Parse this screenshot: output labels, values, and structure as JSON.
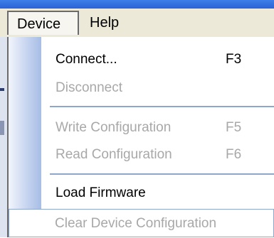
{
  "menubar": {
    "items": [
      {
        "label": "Device"
      },
      {
        "label": "Help"
      }
    ]
  },
  "dropdown": {
    "items": [
      {
        "label": "Connect...",
        "shortcut": "F3",
        "enabled": true
      },
      {
        "label": "Disconnect",
        "shortcut": "",
        "enabled": false
      },
      {
        "label": "Write Configuration",
        "shortcut": "F5",
        "enabled": false
      },
      {
        "label": "Read Configuration",
        "shortcut": "F6",
        "enabled": false
      },
      {
        "label": "Load Firmware",
        "shortcut": "",
        "enabled": true
      },
      {
        "label": "Clear Device Configuration",
        "shortcut": "",
        "enabled": false,
        "highlighted": true
      }
    ]
  }
}
